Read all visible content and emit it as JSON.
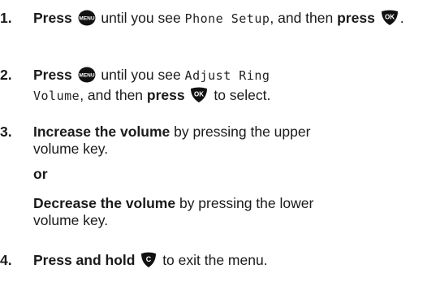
{
  "steps": [
    {
      "num": "1.",
      "press": "Press",
      "key_menu": "MENU",
      "text_until": " until you see ",
      "lcd": "Phone Setup",
      "text_then": ", and then ",
      "press2": "press",
      "key_ok": "OK",
      "end": "."
    },
    {
      "num": "2.",
      "press": "Press",
      "key_menu": "MENU",
      "text_until": " until you see ",
      "lcd_a": "Adjust Ring",
      "lcd_b": "Volume",
      "text_then": ", and then ",
      "press2": "press",
      "key_ok": "OK",
      "end": " to select."
    },
    {
      "num": "3.",
      "bold": "Increase the volume",
      "rest_a": " by pressing the upper",
      "rest_b": "volume key."
    },
    {
      "or": "or",
      "bold": "Decrease the volume",
      "rest_a": " by pressing the lower",
      "rest_b": "volume key."
    },
    {
      "num": "4.",
      "bold": "Press and hold",
      "key_clear": "C",
      "rest": " to exit the menu."
    }
  ]
}
